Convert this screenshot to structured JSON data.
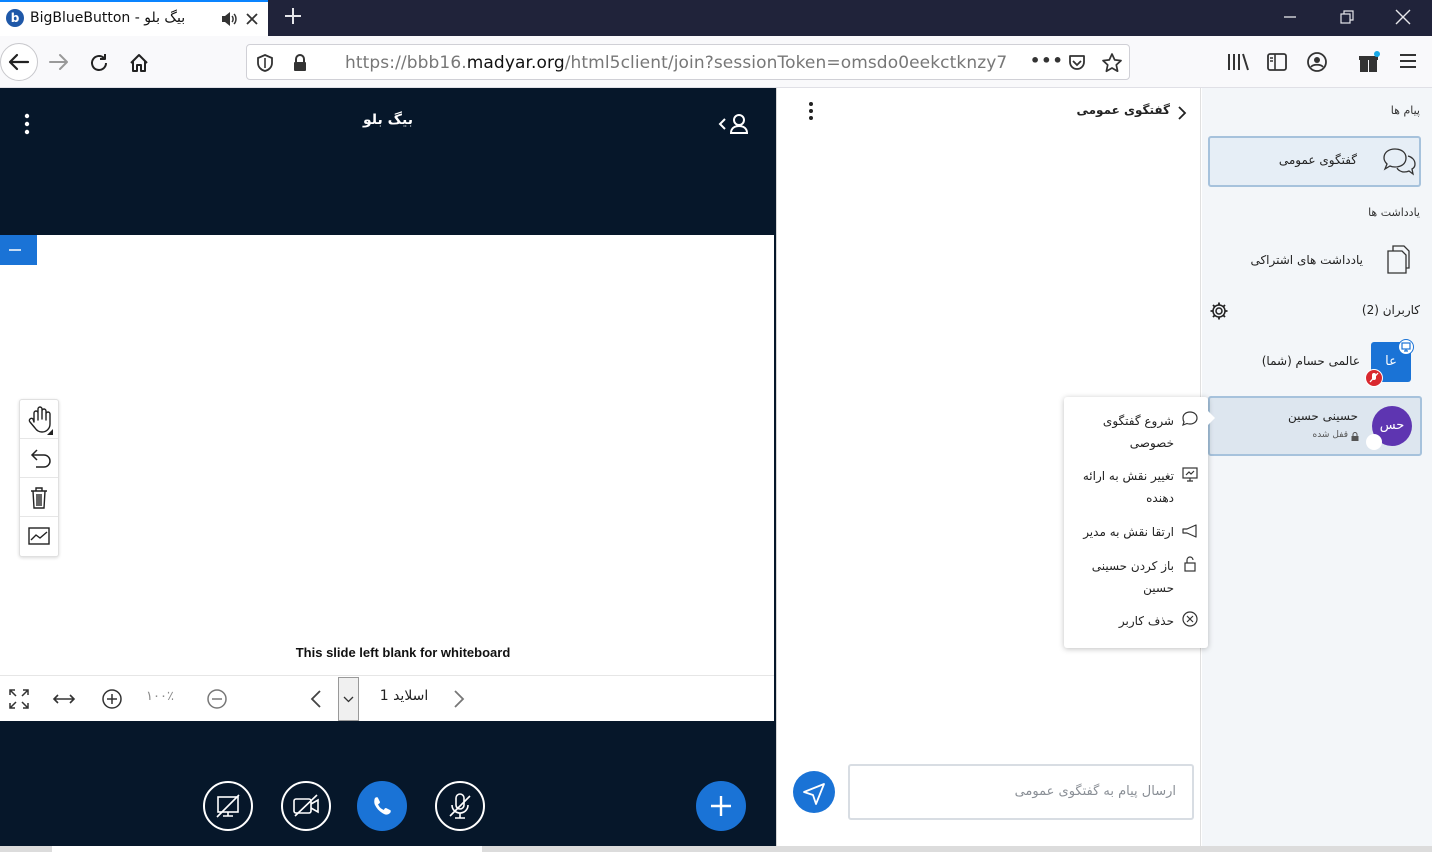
{
  "browser": {
    "tab_title": "BigBlueButton - بیگ بلو",
    "favicon_letter": "b",
    "url_prefix": "https://bbb16.",
    "url_domain": "madyar.org",
    "url_path": "/html5client/join?sessionToken=omsdo0eekctknzy7",
    "url_more": "•••"
  },
  "meeting": {
    "title": "بیگ بلو",
    "slide_caption": "This slide left blank for whiteboard",
    "slide_label": "اسلاید 1",
    "zoom_level": "۱۰۰٪"
  },
  "chat": {
    "header_title": "گفتگوی عمومی",
    "input_placeholder": "ارسال پیام به گفتگوی عمومی"
  },
  "sidebar": {
    "messages_heading": "پیام ها",
    "public_chat_label": "گفتگوی عمومی",
    "notes_heading": "یادداشت ها",
    "shared_notes_label": "یادداشت های اشتراکی",
    "users_heading": "کاربران (2)",
    "users": [
      {
        "initials": "عا",
        "name": "عالمی حسام (شما)",
        "color": "#1a73d6"
      },
      {
        "initials": "حس",
        "name": "حسینی حسین",
        "status": "قفل شده",
        "color": "#5e35b1"
      }
    ]
  },
  "context_menu": {
    "items": [
      {
        "label": "شروع گفتگوی خصوصی",
        "icon": "chat-bubble-icon"
      },
      {
        "label": "تغییر نقش به ارائه دهنده",
        "icon": "presentation-icon"
      },
      {
        "label": "ارتقا نقش به مدیر",
        "icon": "promote-icon"
      },
      {
        "label": "باز کردن حسینی حسین",
        "icon": "unlock-icon"
      },
      {
        "label": "حذف کاربر",
        "icon": "remove-circle-icon"
      }
    ]
  },
  "colors": {
    "accent": "#1a73d6",
    "dark_bg": "#06172a",
    "titlebar": "#20233a"
  }
}
